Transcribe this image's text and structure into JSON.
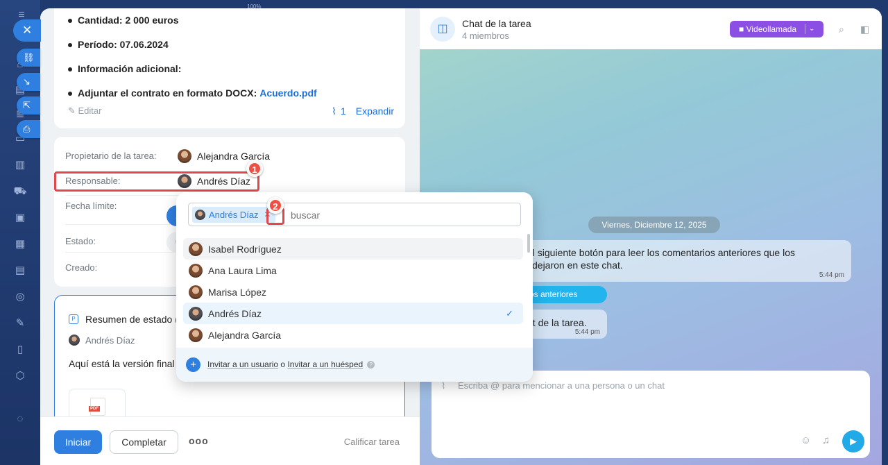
{
  "top_zoom": "100%",
  "description": {
    "items": [
      {
        "label": "Cantidad: 2 000 euros"
      },
      {
        "label": "Período: 07.06.2024"
      },
      {
        "label": "Información adicional:"
      },
      {
        "label": "Adjuntar el contrato en formato DOCX:",
        "link": "Acuerdo.pdf"
      }
    ],
    "edit_label": "Editar",
    "attachments_count": "1",
    "expand_label": "Expandir"
  },
  "properties": {
    "owner_label": "Propietario de la tarea:",
    "owner_name": "Alejandra García",
    "responsible_label": "Responsable:",
    "responsible_name": "Andrés Díaz",
    "deadline_label": "Fecha límite:",
    "status_label": "Estado:",
    "created_label": "Creado:"
  },
  "annotations": {
    "badge1": "1",
    "badge2": "2"
  },
  "status_summary": {
    "title": "Resumen de estado (",
    "author": "Andrés Díaz",
    "text": "Aquí está la versión final d",
    "file_type": "PDF"
  },
  "footer": {
    "start_label": "Iniciar",
    "complete_label": "Completar",
    "more_label": "ooo",
    "rate_label": "Calificar tarea"
  },
  "chat": {
    "title": "Chat de la tarea",
    "members": "4 miembros",
    "video_label": "Videollamada",
    "date_separator": "Viernes, Diciembre 12, 2025",
    "message1_line1": "el siguiente botón para leer los comentarios anteriores que los",
    "message1_line2": "dejaron en este chat.",
    "message1_time": "5:44 pm",
    "previous_label": "os anteriores",
    "message2": "at de la tarea.",
    "message2_time": "5:44 pm",
    "composer_placeholder": "Escriba @ para mencionar a una persona o un chat"
  },
  "dropdown": {
    "selected_chip": "Andrés Díaz",
    "search_placeholder": "buscar",
    "people": [
      {
        "name": "Isabel Rodríguez",
        "gender": "f"
      },
      {
        "name": "Ana Laura Lima",
        "gender": "f"
      },
      {
        "name": "Marisa López",
        "gender": "f"
      },
      {
        "name": "Andrés Díaz",
        "gender": "m",
        "selected": true
      },
      {
        "name": "Alejandra García",
        "gender": "f"
      }
    ],
    "invite_user": "Invitar a un usuario",
    "or": "o",
    "invite_guest": "Invitar a un huésped"
  },
  "colors": {
    "accent": "#2f7fe0",
    "video": "#8b4fe3",
    "annotation": "#e2484b"
  }
}
